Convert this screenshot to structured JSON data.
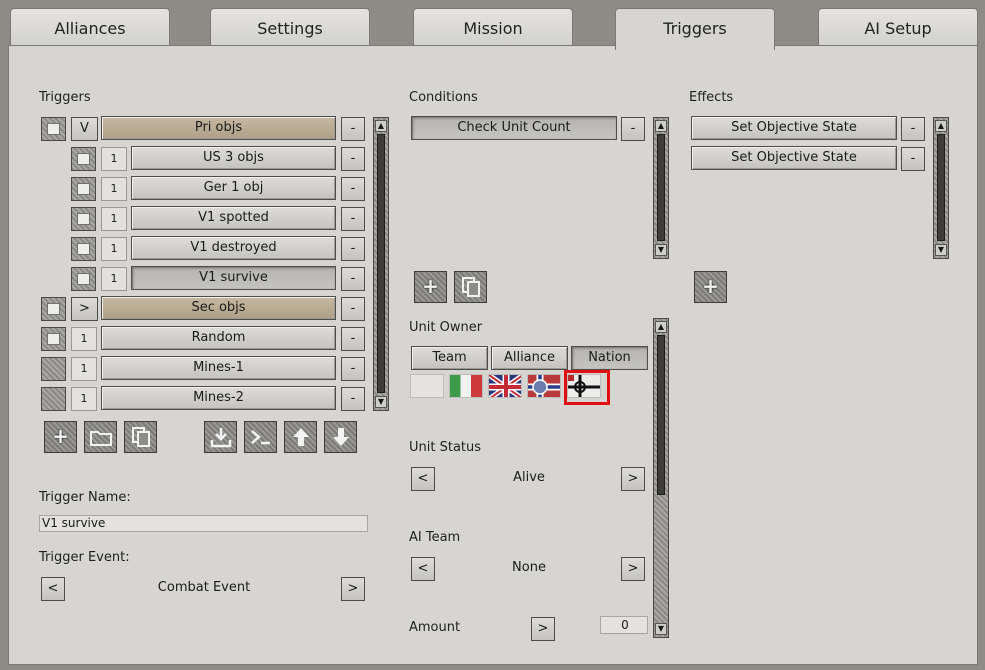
{
  "tabs": [
    {
      "label": "Alliances"
    },
    {
      "label": "Settings"
    },
    {
      "label": "Mission"
    },
    {
      "label": "Triggers",
      "active": true
    },
    {
      "label": "AI Setup"
    }
  ],
  "triggers": {
    "heading": "Triggers",
    "rows": [
      {
        "prefix": "V",
        "label": "Pri objs",
        "remove": "-"
      },
      {
        "prefix": "1",
        "label": "US 3 objs",
        "remove": "-"
      },
      {
        "prefix": "1",
        "label": "Ger 1 obj",
        "remove": "-"
      },
      {
        "prefix": "1",
        "label": "V1 spotted",
        "remove": "-"
      },
      {
        "prefix": "1",
        "label": "V1 destroyed",
        "remove": "-"
      },
      {
        "prefix": "1",
        "label": "V1 survive",
        "remove": "-",
        "selected": true
      },
      {
        "prefix": ">",
        "label": "Sec objs",
        "remove": "-"
      },
      {
        "prefix": "1",
        "label": "Random",
        "remove": "-"
      },
      {
        "prefix": "1",
        "label": "Mines-1",
        "remove": "-"
      },
      {
        "prefix": "1",
        "label": "Mines-2",
        "remove": "-"
      }
    ],
    "toolbar_icons": [
      "add-icon",
      "folder-icon",
      "copy-icon",
      "import-icon",
      "console-icon",
      "arrow-up-icon",
      "arrow-down-icon"
    ],
    "name_label": "Trigger Name:",
    "name_value": "V1 survive",
    "event_label": "Trigger Event:",
    "event_value": "Combat Event",
    "prev": "<",
    "next": ">"
  },
  "conditions": {
    "heading": "Conditions",
    "items": [
      {
        "label": "Check Unit Count",
        "remove": "-"
      }
    ],
    "unit_owner": {
      "label": "Unit Owner",
      "tabs": [
        "Team",
        "Alliance",
        "Nation"
      ],
      "active_tab": "Nation",
      "flags": [
        "neutral-flag",
        "italy-flag",
        "uk-flag",
        "norway-flag",
        "germany-flag"
      ],
      "selected_flag": "germany-flag",
      "highlight_color": "#e01010"
    },
    "unit_status": {
      "label": "Unit Status",
      "value": "Alive",
      "prev": "<",
      "next": ">"
    },
    "ai_team": {
      "label": "AI Team",
      "value": "None",
      "prev": "<",
      "next": ">"
    },
    "amount": {
      "label": "Amount",
      "next": ">",
      "value": "0"
    }
  },
  "effects": {
    "heading": "Effects",
    "items": [
      {
        "label": "Set Objective State",
        "remove": "-"
      },
      {
        "label": "Set Objective State",
        "remove": "-"
      }
    ]
  }
}
